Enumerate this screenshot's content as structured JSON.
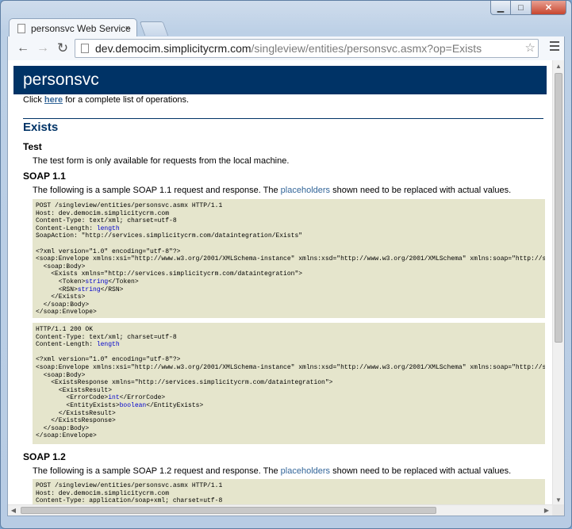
{
  "browser": {
    "tab_title": "personsvc Web Service",
    "tab_close": "×",
    "url_host": "dev.democim.simplicitycrm.com",
    "url_path": "/singleview/entities/personsvc.asmx?op=Exists",
    "back_glyph": "←",
    "forward_glyph": "→",
    "reload_glyph": "↻",
    "star_glyph": "☆",
    "minimize_glyph": "▁",
    "maximize_glyph": "□",
    "close_glyph": "✕"
  },
  "page": {
    "heading": "personsvc",
    "intro_before": "Click ",
    "intro_link": "here",
    "intro_after": " for a complete list of operations.",
    "operation": "Exists",
    "test_heading": "Test",
    "test_text": "The test form is only available for requests from the local machine.",
    "soap11_heading": "SOAP 1.1",
    "soap11_before": "The following is a sample SOAP 1.1 request and response.  The ",
    "soap11_link": "placeholders",
    "soap11_after": " shown need to be replaced with actual values.",
    "soap12_heading": "SOAP 1.2",
    "soap12_before": "The following is a sample SOAP 1.2 request and response.  The ",
    "soap12_link": "placeholders",
    "soap12_after": " shown need to be replaced with actual values."
  },
  "samples": {
    "req11": {
      "l1": "POST /singleview/entities/personsvc.asmx HTTP/1.1",
      "l2": "Host: dev.democim.simplicitycrm.com",
      "l3": "Content-Type: text/xml; charset=utf-8",
      "l4": "Content-Length: ",
      "l4_ph": "length",
      "l5": "SoapAction: \"http://services.simplicitycrm.com/dataintegration/Exists\"",
      "l6": "<?xml version=\"1.0\" encoding=\"utf-8\"?>",
      "l7": "<soap:Envelope xmlns:xsi=\"http://www.w3.org/2001/XMLSchema-instance\" xmlns:xsd=\"http://www.w3.org/2001/XMLSchema\" xmlns:soap=\"http://schemas.xmlsoap.org/soap/envelope/\">",
      "l8": "  <soap:Body>",
      "l9": "    <Exists xmlns=\"http://services.simplicitycrm.com/dataintegration\">",
      "l10a": "      <Token>",
      "l10_ph": "string",
      "l10b": "</Token>",
      "l11a": "      <RSN>",
      "l11_ph": "string",
      "l11b": "</RSN>",
      "l12": "    </Exists>",
      "l13": "  </soap:Body>",
      "l14": "</soap:Envelope>"
    },
    "resp11": {
      "l1": "HTTP/1.1 200 OK",
      "l2": "Content-Type: text/xml; charset=utf-8",
      "l3": "Content-Length: ",
      "l3_ph": "length",
      "l4": "<?xml version=\"1.0\" encoding=\"utf-8\"?>",
      "l5": "<soap:Envelope xmlns:xsi=\"http://www.w3.org/2001/XMLSchema-instance\" xmlns:xsd=\"http://www.w3.org/2001/XMLSchema\" xmlns:soap=\"http://schemas.xmlsoap.org/soap/envelope/\">",
      "l6": "  <soap:Body>",
      "l7": "    <ExistsResponse xmlns=\"http://services.simplicitycrm.com/dataintegration\">",
      "l8": "      <ExistsResult>",
      "l9a": "        <ErrorCode>",
      "l9_ph": "int",
      "l9b": "</ErrorCode>",
      "l10a": "        <EntityExists>",
      "l10_ph": "boolean",
      "l10b": "</EntityExists>",
      "l11": "      </ExistsResult>",
      "l12": "    </ExistsResponse>",
      "l13": "  </soap:Body>",
      "l14": "</soap:Envelope>"
    },
    "req12": {
      "l1": "POST /singleview/entities/personsvc.asmx HTTP/1.1",
      "l2": "Host: dev.democim.simplicitycrm.com",
      "l3": "Content-Type: application/soap+xml; charset=utf-8"
    }
  }
}
